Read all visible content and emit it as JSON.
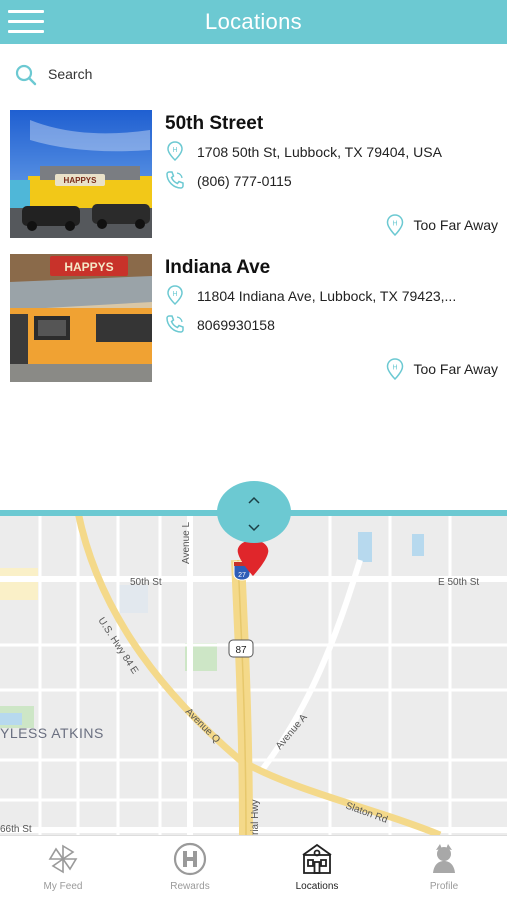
{
  "header": {
    "title": "Locations"
  },
  "search": {
    "placeholder": "Search"
  },
  "locations": [
    {
      "name": "50th Street",
      "address": "1708 50th St, Lubbock, TX 79404, USA",
      "phone": "(806) 777-0115",
      "distance": "Too Far Away",
      "sign_text": "HAPPYS"
    },
    {
      "name": "Indiana Ave",
      "address": "11804 Indiana Ave, Lubbock, TX 79423,...",
      "phone": "8069930158",
      "distance": "Too Far Away",
      "sign_text": "HAPPYS"
    }
  ],
  "map": {
    "labels": {
      "avenue_l": "Avenue L",
      "fiftieth_st_w": "50th St",
      "fiftieth_st_e": "E 50th St",
      "us_hwy": "U.S. Hwy 84 E",
      "avenue_q": "Avenue Q",
      "avenue_a": "Avenue A",
      "neighborhood": "YLESS ATKINS",
      "slaton_rd": "Slaton Rd",
      "memorial_hwy": "rial Hwy",
      "sixtysixth_st": "66th St",
      "shield_27": "27",
      "shield_87": "87"
    }
  },
  "tabs": [
    {
      "label": "My Feed",
      "icon": "pinwheel-icon"
    },
    {
      "label": "Rewards",
      "icon": "rewards-h-icon"
    },
    {
      "label": "Locations",
      "icon": "store-icon"
    },
    {
      "label": "Profile",
      "icon": "profile-icon"
    }
  ],
  "colors": {
    "accent": "#6cc9d2",
    "pin": "#e0262b",
    "highway": "#f4d98a",
    "map_bg": "#ececec"
  }
}
